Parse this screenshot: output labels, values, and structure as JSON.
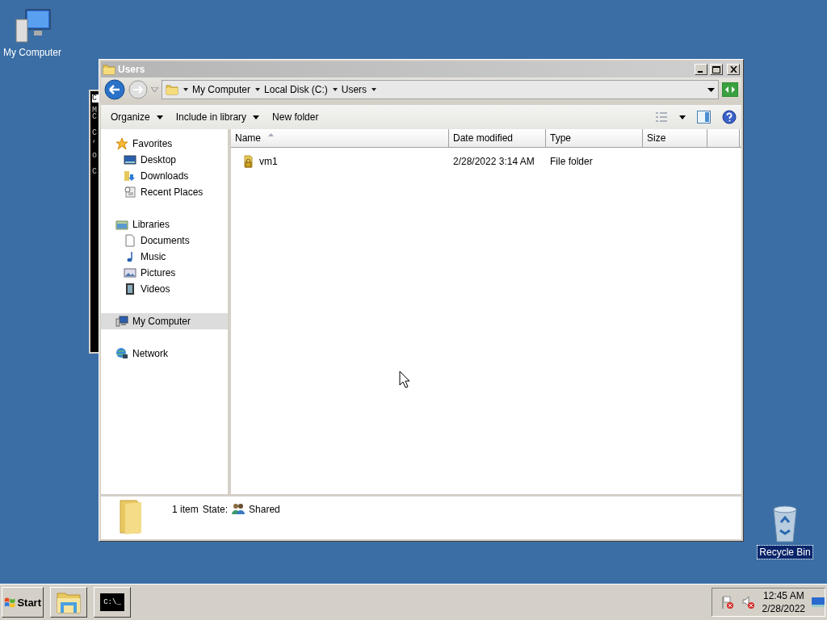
{
  "desktop_icons": [
    {
      "kind": "computer",
      "label": "My Computer",
      "selected": false
    },
    {
      "kind": "recycle",
      "label": "Recycle Bin",
      "selected": true
    }
  ],
  "console_window": {
    "title": "C",
    "blocks": [
      [
        "M",
        "C"
      ],
      [
        "C",
        ","
      ],
      [
        "o"
      ],
      [
        "C"
      ]
    ]
  },
  "explorer": {
    "title": "Users",
    "address": {
      "segments": [
        "My Computer",
        "Local Disk (C:)",
        "Users"
      ]
    },
    "commands": [
      {
        "label": "Organize",
        "dropdown": true
      },
      {
        "label": "Include in library",
        "dropdown": true
      },
      {
        "label": "New folder",
        "dropdown": false
      }
    ],
    "navigation": [
      {
        "label": "Favorites",
        "kind": "star",
        "selected": false,
        "children": [
          {
            "label": "Desktop",
            "kind": "desktop",
            "selected": false
          },
          {
            "label": "Downloads",
            "kind": "downloads",
            "selected": false
          },
          {
            "label": "Recent Places",
            "kind": "recent",
            "selected": false
          }
        ]
      },
      {
        "label": "Libraries",
        "kind": "library",
        "selected": false,
        "children": [
          {
            "label": "Documents",
            "kind": "document",
            "selected": false
          },
          {
            "label": "Music",
            "kind": "music",
            "selected": false
          },
          {
            "label": "Pictures",
            "kind": "pictures",
            "selected": false
          },
          {
            "label": "Videos",
            "kind": "video",
            "selected": false
          }
        ]
      },
      {
        "label": "My Computer",
        "kind": "computer",
        "selected": true
      },
      {
        "label": "Network",
        "kind": "network",
        "selected": false
      }
    ],
    "columns": [
      {
        "label": "Name",
        "sorted": true
      },
      {
        "label": "Date modified",
        "sorted": false
      },
      {
        "label": "Type",
        "sorted": false
      },
      {
        "label": "Size",
        "sorted": false
      }
    ],
    "rows": [
      {
        "name": "vm1",
        "date_modified": "2/28/2022 3:14 AM",
        "type": "File folder",
        "locked": true
      }
    ],
    "details": {
      "count": "1 item",
      "state_label": "State:",
      "state_value": "Shared"
    }
  },
  "taskbar": {
    "start": "Start",
    "buttons": [
      {
        "kind": "explorer"
      },
      {
        "kind": "console",
        "label": "C:\\_"
      }
    ],
    "tray": [
      {
        "kind": "flag"
      },
      {
        "kind": "speaker"
      }
    ],
    "clock": {
      "time": "12:45 AM",
      "date": "2/28/2022"
    }
  }
}
